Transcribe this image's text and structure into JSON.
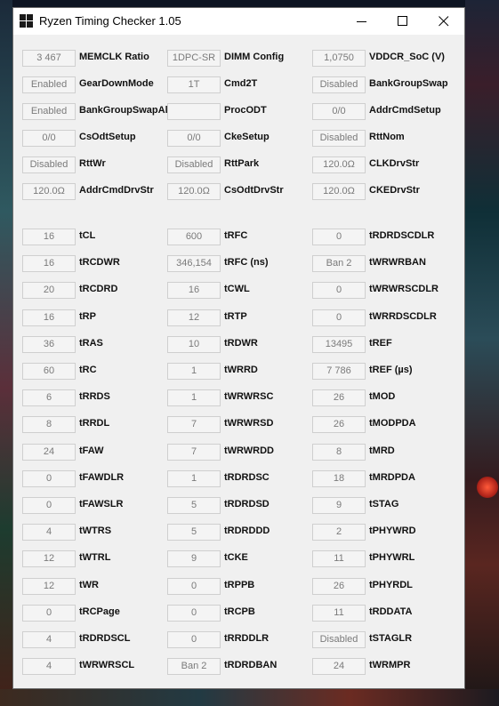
{
  "window": {
    "title": "Ryzen Timing Checker 1.05"
  },
  "section1": [
    {
      "label": "MEMCLK Ratio",
      "value": "3 467"
    },
    {
      "label": "DIMM Config",
      "value": "1DPC-SR"
    },
    {
      "label": "VDDCR_SoC (V)",
      "value": "1,0750"
    },
    {
      "label": "GearDownMode",
      "value": "Enabled"
    },
    {
      "label": "Cmd2T",
      "value": "1T"
    },
    {
      "label": "BankGroupSwap",
      "value": "Disabled"
    },
    {
      "label": "BankGroupSwapAlt",
      "value": "Enabled"
    },
    {
      "label": "ProcODT",
      "value": ""
    },
    {
      "label": "AddrCmdSetup",
      "value": "0/0"
    },
    {
      "label": "CsOdtSetup",
      "value": "0/0"
    },
    {
      "label": "CkeSetup",
      "value": "0/0"
    },
    {
      "label": "RttNom",
      "value": "Disabled"
    },
    {
      "label": "RttWr",
      "value": "Disabled"
    },
    {
      "label": "RttPark",
      "value": "Disabled"
    },
    {
      "label": "CLKDrvStr",
      "value": "120.0Ω"
    },
    {
      "label": "AddrCmdDrvStr",
      "value": "120.0Ω"
    },
    {
      "label": "CsOdtDrvStr",
      "value": "120.0Ω"
    },
    {
      "label": "CKEDrvStr",
      "value": "120.0Ω"
    }
  ],
  "section2": [
    {
      "label": "tCL",
      "value": "16"
    },
    {
      "label": "tRFC",
      "value": "600"
    },
    {
      "label": "tRDRDSCDLR",
      "value": "0"
    },
    {
      "label": "tRCDWR",
      "value": "16"
    },
    {
      "label": "tRFC (ns)",
      "value": "346,154"
    },
    {
      "label": "tWRWRBAN",
      "value": "Ban 2"
    },
    {
      "label": "tRCDRD",
      "value": "20"
    },
    {
      "label": "tCWL",
      "value": "16"
    },
    {
      "label": "tWRWRSCDLR",
      "value": "0"
    },
    {
      "label": "tRP",
      "value": "16"
    },
    {
      "label": "tRTP",
      "value": "12"
    },
    {
      "label": "tWRRDSCDLR",
      "value": "0"
    },
    {
      "label": "tRAS",
      "value": "36"
    },
    {
      "label": "tRDWR",
      "value": "10"
    },
    {
      "label": "tREF",
      "value": "13495"
    },
    {
      "label": "tRC",
      "value": "60"
    },
    {
      "label": "tWRRD",
      "value": "1"
    },
    {
      "label": "tREF (µs)",
      "value": "7 786"
    },
    {
      "label": "tRRDS",
      "value": "6"
    },
    {
      "label": "tWRWRSC",
      "value": "1"
    },
    {
      "label": "tMOD",
      "value": "26"
    },
    {
      "label": "tRRDL",
      "value": "8"
    },
    {
      "label": "tWRWRSD",
      "value": "7"
    },
    {
      "label": "tMODPDA",
      "value": "26"
    },
    {
      "label": "tFAW",
      "value": "24"
    },
    {
      "label": "tWRWRDD",
      "value": "7"
    },
    {
      "label": "tMRD",
      "value": "8"
    },
    {
      "label": "tFAWDLR",
      "value": "0"
    },
    {
      "label": "tRDRDSC",
      "value": "1"
    },
    {
      "label": "tMRDPDA",
      "value": "18"
    },
    {
      "label": "tFAWSLR",
      "value": "0"
    },
    {
      "label": "tRDRDSD",
      "value": "5"
    },
    {
      "label": "tSTAG",
      "value": "9"
    },
    {
      "label": "tWTRS",
      "value": "4"
    },
    {
      "label": "tRDRDDD",
      "value": "5"
    },
    {
      "label": "tPHYWRD",
      "value": "2"
    },
    {
      "label": "tWTRL",
      "value": "12"
    },
    {
      "label": "tCKE",
      "value": "9"
    },
    {
      "label": "tPHYWRL",
      "value": "11"
    },
    {
      "label": "tWR",
      "value": "12"
    },
    {
      "label": "tRPPB",
      "value": "0"
    },
    {
      "label": "tPHYRDL",
      "value": "26"
    },
    {
      "label": "tRCPage",
      "value": "0"
    },
    {
      "label": "tRCPB",
      "value": "0"
    },
    {
      "label": "tRDDATA",
      "value": "11"
    },
    {
      "label": "tRDRDSCL",
      "value": "4"
    },
    {
      "label": "tRRDDLR",
      "value": "0"
    },
    {
      "label": "tSTAGLR",
      "value": "Disabled"
    },
    {
      "label": "tWRWRSCL",
      "value": "4"
    },
    {
      "label": "tRDRDBAN",
      "value": "Ban 2"
    },
    {
      "label": "tWRMPR",
      "value": "24"
    }
  ]
}
